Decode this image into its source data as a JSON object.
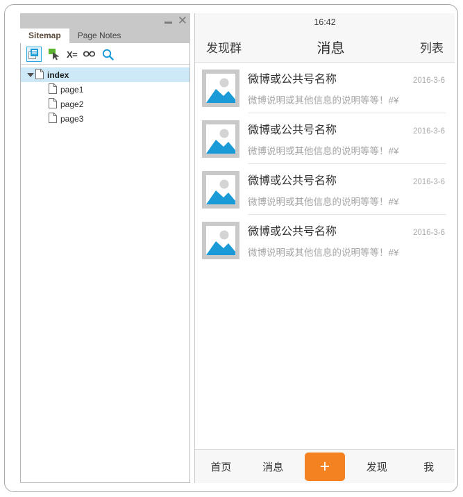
{
  "left_panel": {
    "window_buttons": {
      "minimize": "minimize-icon",
      "close": "close-icon"
    },
    "tabs": [
      {
        "label": "Sitemap",
        "active": true
      },
      {
        "label": "Page Notes",
        "active": false
      }
    ],
    "toolbar_icons": [
      {
        "name": "add-page-icon",
        "selected": true
      },
      {
        "name": "cursor-select-icon",
        "selected": false
      },
      {
        "name": "variables-icon",
        "label": "X=",
        "selected": false
      },
      {
        "name": "link-icon",
        "selected": false
      },
      {
        "name": "search-icon",
        "selected": false
      }
    ],
    "tree": {
      "root": {
        "label": "index",
        "expanded": true,
        "selected": true
      },
      "children": [
        {
          "label": "page1"
        },
        {
          "label": "page2"
        },
        {
          "label": "page3"
        }
      ]
    }
  },
  "phone": {
    "status_bar": {
      "time": "16:42"
    },
    "nav_bar": {
      "left_label": "发现群",
      "title": "消息",
      "right_label": "列表"
    },
    "list_rows": [
      {
        "thumbnail": "image-placeholder-icon",
        "title": "微博或公共号名称",
        "date": "2016-3-6",
        "subtitle": "微博说明或其他信息的说明等等！#¥"
      },
      {
        "thumbnail": "image-placeholder-icon",
        "title": "微博或公共号名称",
        "date": "2016-3-6",
        "subtitle": "微博说明或其他信息的说明等等！#¥"
      },
      {
        "thumbnail": "image-placeholder-icon",
        "title": "微博或公共号名称",
        "date": "2016-3-6",
        "subtitle": "微博说明或其他信息的说明等等！#¥"
      },
      {
        "thumbnail": "image-placeholder-icon",
        "title": "微博或公共号名称",
        "date": "2016-3-6",
        "subtitle": "微博说明或其他信息的说明等等！#¥"
      }
    ],
    "tab_bar": {
      "items": [
        {
          "label": "首页"
        },
        {
          "label": "消息"
        }
      ],
      "center_button": {
        "label": "+",
        "color": "#f58220"
      },
      "items_right": [
        {
          "label": "发现"
        },
        {
          "label": "我"
        }
      ]
    }
  },
  "colors": {
    "accent_blue": "#2aa8e0",
    "thumb_blue": "#1a9bd7",
    "tree_selection": "#cde8f6",
    "orange": "#f58220",
    "titlebar_gray": "#c8c8c8"
  }
}
